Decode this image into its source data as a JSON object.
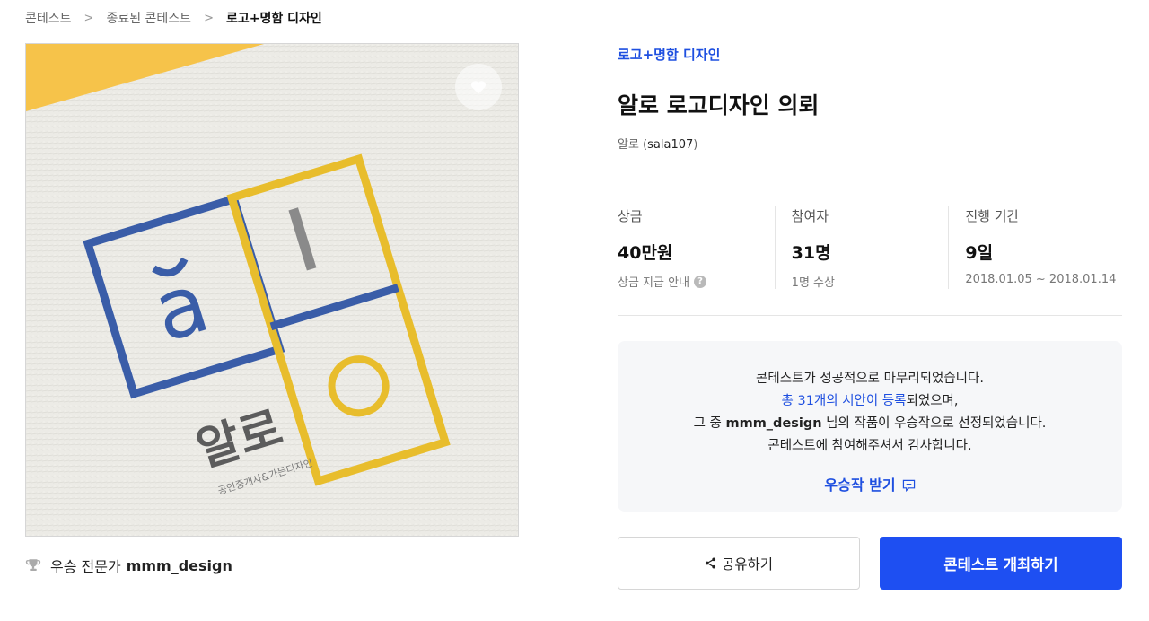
{
  "breadcrumb": {
    "items": [
      "콘테스트",
      "종료된 콘테스트",
      "로고+명함 디자인"
    ],
    "separator": ">"
  },
  "artwork": {
    "logo_wordmark": "알로",
    "logo_subtext": "공인중개사&가든디자인",
    "colors": {
      "blue": "#3a5da8",
      "yellow": "#e8bd2c",
      "corner": "#f6c34a",
      "paper": "#ecebe6"
    },
    "like_icon": "heart-icon"
  },
  "winner": {
    "icon": "trophy-icon",
    "label": "우승 전문가",
    "name": "mmm_design"
  },
  "contest": {
    "category": "로고+명함 디자인",
    "title": "알로 로고디자인 의뢰",
    "owner_name": "알로",
    "owner_id": "sala107"
  },
  "stats": [
    {
      "label": "상금",
      "value": "40만원",
      "sub": "상금 지급 안내",
      "sub_icon": "help-icon",
      "sub_icon_glyph": "?"
    },
    {
      "label": "참여자",
      "value": "31명",
      "sub": "1명 수상"
    },
    {
      "label": "진행 기간",
      "value": "9일",
      "sub": "2018.01.05 ~ 2018.01.14"
    }
  ],
  "notice": {
    "line1": "콘테스트가 성공적으로 마무리되었습니다.",
    "line2_link": "총 31개의 시안이 등록",
    "line2_rest": "되었으며,",
    "line3_prefix": "그 중 ",
    "line3_name": "mmm_design",
    "line3_rest": " 님의 작품이 우승작으로 선정되었습니다.",
    "line4": "콘테스트에 참여해주셔서 감사합니다.",
    "cta": "우승작 받기",
    "cta_icon": "message-icon"
  },
  "buttons": {
    "share": "공유하기",
    "share_icon": "share-icon",
    "host": "콘테스트 개최하기"
  },
  "theme": {
    "accent": "#1e4ff2",
    "link": "#1e4fe0"
  }
}
